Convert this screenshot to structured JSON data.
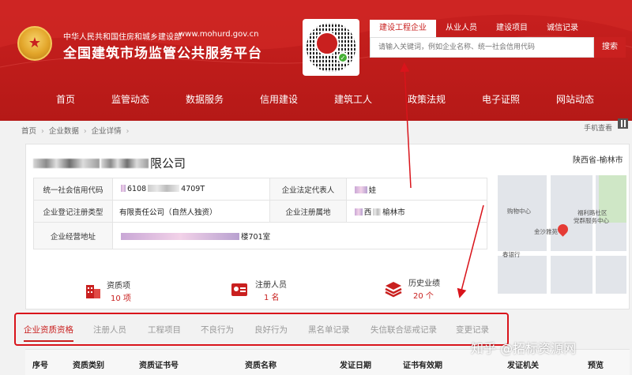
{
  "header": {
    "gov_name": "中华人民共和国住房和城乡建设部",
    "gov_url": "www.mohurd.gov.cn",
    "site_title": "全国建筑市场监管公共服务平台",
    "search_tabs": [
      {
        "label": "建设工程企业",
        "active": true
      },
      {
        "label": "从业人员",
        "active": false
      },
      {
        "label": "建设项目",
        "active": false
      },
      {
        "label": "诚信记录",
        "active": false
      }
    ],
    "search_placeholder": "请输入关键词，例如企业名称、统一社会信用代码",
    "search_button": "搜索"
  },
  "nav": {
    "items": [
      "首页",
      "监管动态",
      "数据服务",
      "信用建设",
      "建筑工人",
      "政策法规",
      "电子证照",
      "网站动态"
    ]
  },
  "breadcrumb": [
    "首页",
    "企业数据",
    "企业详情"
  ],
  "mobile_view": "手机查看",
  "company": {
    "name_suffix": "限公司",
    "region": "陕西省-榆林市",
    "fields": {
      "credit_code_label": "统一社会信用代码",
      "credit_code_prefix": "6108",
      "credit_code_suffix": "4709T",
      "legal_rep_label": "企业法定代表人",
      "legal_rep_value": "娃",
      "reg_type_label": "企业登记注册类型",
      "reg_type_value": "有限责任公司（自然人独资）",
      "reg_place_label": "企业注册属地",
      "reg_place_prefix": "西",
      "reg_place_value": "榆林市",
      "address_label": "企业经营地址",
      "address_suffix": "楼701室"
    }
  },
  "map": {
    "labels": [
      "购物中心",
      "福利路社区",
      "党群服务中心",
      "金沙雅苑",
      "春银行"
    ]
  },
  "stats": [
    {
      "label": "资质项",
      "count": "10 项",
      "icon": "building-icon"
    },
    {
      "label": "注册人员",
      "count": "1 名",
      "icon": "id-card-icon"
    },
    {
      "label": "历史业绩",
      "count": "20 个",
      "icon": "layers-icon"
    }
  ],
  "tabs": [
    {
      "label": "企业资质资格",
      "active": true
    },
    {
      "label": "注册人员",
      "active": false
    },
    {
      "label": "工程项目",
      "active": false
    },
    {
      "label": "不良行为",
      "active": false
    },
    {
      "label": "良好行为",
      "active": false
    },
    {
      "label": "黑名单记录",
      "active": false
    },
    {
      "label": "失信联合惩戒记录",
      "active": false
    },
    {
      "label": "变更记录",
      "active": false
    }
  ],
  "table_headers": [
    "序号",
    "资质类别",
    "资质证书号",
    "资质名称",
    "发证日期",
    "证书有效期",
    "发证机关",
    "预览"
  ],
  "watermark": "知乎 @招标资源网",
  "colors": {
    "brand_red": "#c9201f",
    "annotation_red": "#d9141b"
  }
}
